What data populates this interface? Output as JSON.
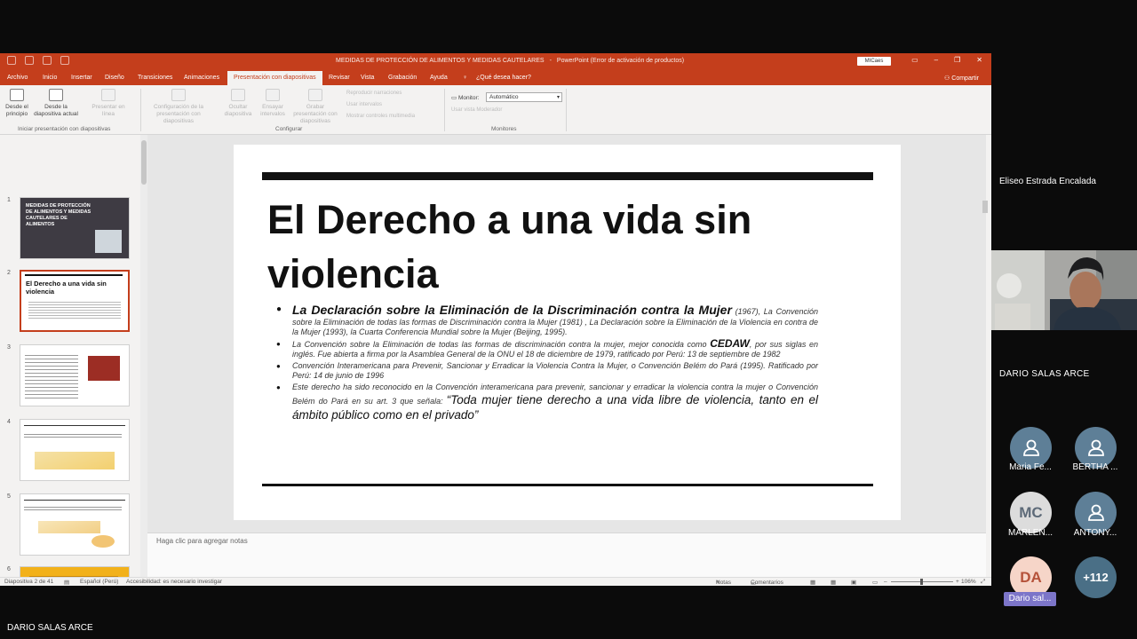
{
  "window": {
    "title": "MEDIDAS DE PROTECCIÓN DE ALIMENTOS Y MEDIDAS CAUTELARES",
    "app": "PowerPoint (Error de activación de productos)",
    "user_badge": "MICaes",
    "share": "Compartir"
  },
  "menu": {
    "tabs": [
      "Archivo",
      "Inicio",
      "Insertar",
      "Diseño",
      "Transiciones",
      "Animaciones",
      "Presentación con diapositivas",
      "Revisar",
      "Vista",
      "Grabación",
      "Ayuda"
    ],
    "active_tab": "Presentación con diapositivas",
    "search": "¿Qué desea hacer?"
  },
  "ribbon": {
    "from_beginning": "Desde el principio",
    "from_current": "Desde la diapositiva actual",
    "present_online": "Presentar en línea",
    "custom_show": "Presentación personalizada",
    "group_start": "Iniciar presentación con diapositivas",
    "setup_show": "Configuración de la presentación con diapositivas",
    "hide_slide": "Ocultar diapositiva",
    "rehearse": "Ensayar intervalos",
    "record": "Grabar presentación con diapositivas",
    "play_narrations": "Reproducir narraciones",
    "use_timings": "Usar intervalos",
    "show_media_controls": "Mostrar controles multimedia",
    "group_config": "Configurar",
    "monitor_label": "Monitor:",
    "monitor_value": "Automático",
    "presenter_view": "Usar vista Moderador",
    "group_monitors": "Monitores"
  },
  "thumbnails": {
    "numbers": [
      "1",
      "2",
      "3",
      "4",
      "5",
      "6"
    ],
    "slide1_title": "MEDIDAS DE PROTECCIÓN DE ALIMENTOS Y MEDIDAS CAUTELARES DE ALIMENTOS",
    "slide2_title": "El Derecho a una vida sin violencia"
  },
  "slide": {
    "title": "El Derecho a una vida sin violencia",
    "bullet1_lead": "La Declaración sobre la Eliminación de la Discriminación contra la Mujer",
    "bullet1_rest": " (1967), La Convención sobre la Eliminación de todas las formas de Discriminación contra la Mujer (1981) , La Declaración sobre la Eliminación de la Violencia en contra de la Mujer (1993), la Cuarta Conferencia Mundial sobre la Mujer (Beijing, 1995).",
    "bullet2_a": "La Convención sobre la Eliminación de todas las formas de discriminación contra la mujer, mejor conocida como ",
    "bullet2_cedaw": "CEDAW",
    "bullet2_b": ", por sus siglas en inglés. Fue abierta a firma por la Asamblea General de la ONU el 18 de diciembre de 1979, ratificado por Perú: 13 de septiembre de 1982",
    "bullet3": "Convención Interamericana para Prevenir, Sancionar y Erradicar la Violencia Contra la Mujer, o Convención Belém do Pará (1995).  Ratificado por Perú: 14 de junio de 1996",
    "bullet4_a": "Este derecho ha sido reconocido en la Convención interamericana para prevenir, sancionar y erradicar la violencia contra la mujer o Convención Belém do Pará en su art. 3 que señala: ",
    "bullet4_quote": "“Toda mujer tiene derecho a una vida libre de violencia, tanto en el ámbito público como en el privado”"
  },
  "notes_placeholder": "Haga clic para agregar notas",
  "status": {
    "slide_count": "Diapositiva 2 de 41",
    "language": "Español (Perú)",
    "accessibility": "Accesibilidad: es necesario investigar",
    "notes": "Notas",
    "comments": "Comentarios",
    "zoom": "106%"
  },
  "meeting": {
    "speaker_name": "Eliseo Estrada Encalada",
    "tile_name": "DARIO SALAS ARCE",
    "participants": [
      {
        "label": "Maria Fe..."
      },
      {
        "label": "BERTHA ..."
      },
      {
        "initials": "MC",
        "label": "MARLEN..."
      },
      {
        "label": "ANTONY..."
      },
      {
        "initials": "DA",
        "label": "Dario sal..."
      }
    ],
    "more_count": "+112",
    "presenter": "DARIO SALAS ARCE"
  }
}
